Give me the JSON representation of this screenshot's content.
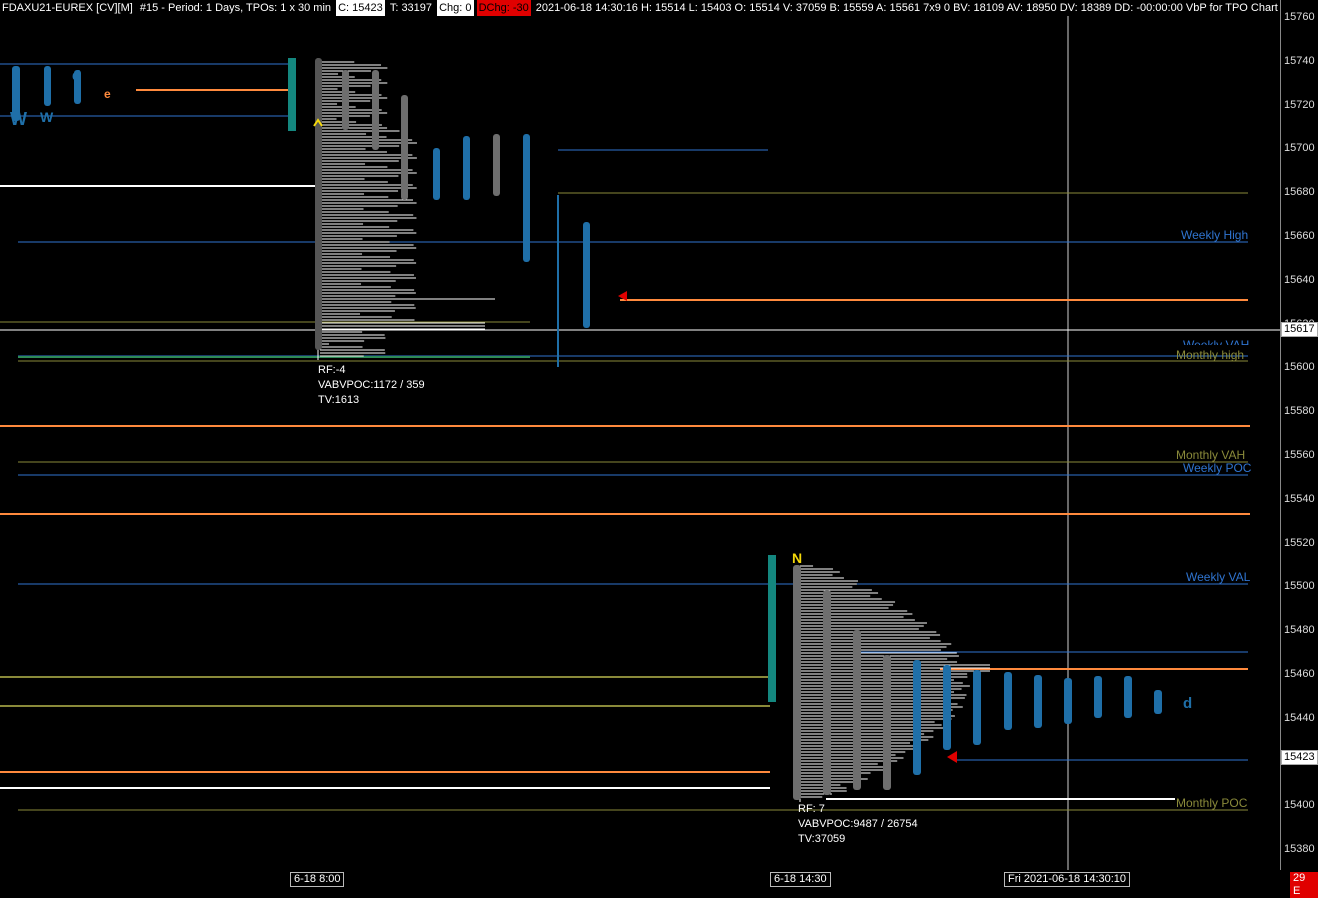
{
  "header": {
    "symbol": "FDAXU21-EUREX [CV][M]",
    "info": "#15 - Period: 1 Days, TPOs: 1 x 30 min",
    "close": "C: 15423",
    "ticks": "T: 33197",
    "chg": "Chg: 0",
    "dchg": "DChg: -30",
    "details": "2021-06-18 14:30:16 H: 15514 L: 15403 O: 15514 V: 37059 B: 15559 A: 15561 7x9 0 BV: 18109 AV: 18950 DV: 18389 DD: -00:00:00 VbP for TPO Chart"
  },
  "time_axis": {
    "label_1": "6-18  8:00",
    "label_2": "6-18  14:30",
    "cursor": "Fri 2021-06-18  14:30:10",
    "corner": "29 E"
  },
  "price_axis": {
    "ticks": [
      "15760",
      "15740",
      "15720",
      "15700",
      "15680",
      "15660",
      "15640",
      "15620",
      "15600",
      "15580",
      "15560",
      "15540",
      "15520",
      "15500",
      "15480",
      "15460",
      "15440",
      "15420",
      "15400",
      "15380"
    ],
    "current_price": "15617",
    "last_price": "15423"
  },
  "profile_1_stats": {
    "rf": "RF:-4",
    "vabvpoc": "VABVPOC:1172 / 359",
    "tv": "TV:1613"
  },
  "profile_2_stats": {
    "rf": "RF: 7",
    "vabvpoc": "VABVPOC:9487 / 26754",
    "tv": "TV:37059"
  },
  "level_labels": {
    "weekly_high": "Weekly High",
    "weekly_val_top": "Weekly VAH",
    "monthly_high": "Monthly high",
    "monthly_vah": "Monthly VAH",
    "weekly_poc": "Weekly POC",
    "weekly_val": "Weekly VAL",
    "monthly_poc": "Monthly POC"
  },
  "tpo_letters": {
    "p1": [
      "W",
      "W",
      "d",
      "e"
    ],
    "p2_open": "N",
    "p2_last": "d"
  },
  "colors": {
    "background": "#000000",
    "weekly": "#2f74d0",
    "monthly": "#8a8a3a",
    "orange": "#ff8a3d",
    "tpo_blue": "#1f6fa8",
    "tpo_grey": "#6e6e6e",
    "teal_bar": "#14877f",
    "white_line": "#ffffff",
    "red_marker": "#e00000"
  },
  "chart_data": {
    "type": "tpo_market_profile",
    "instrument": "FDAXU21-EUREX",
    "y_range": [
      15375,
      15765
    ],
    "levels": [
      {
        "name": "Weekly High",
        "price": 15657,
        "color": "#2f74d0"
      },
      {
        "name": "Weekly VAH",
        "price": 15604,
        "color": "#2f74d0"
      },
      {
        "name": "Monthly high",
        "price": 15603,
        "color": "#8a8a3a"
      },
      {
        "name": "Monthly VAH",
        "price": 15557,
        "color": "#8a8a3a"
      },
      {
        "name": "Weekly POC",
        "price": 15551,
        "color": "#2f74d0"
      },
      {
        "name": "Weekly VAL",
        "price": 15501,
        "color": "#2f74d0"
      },
      {
        "name": "Monthly POC",
        "price": 15398,
        "color": "#8a8a3a"
      }
    ],
    "current_price": 15617,
    "last_price": 15423,
    "profiles": [
      {
        "date": "6-18 8:00",
        "high": 15740,
        "low": 15604,
        "poc": 15630
      },
      {
        "date": "6-18 14:30",
        "high": 15514,
        "low": 15403,
        "poc": 15462
      }
    ]
  }
}
